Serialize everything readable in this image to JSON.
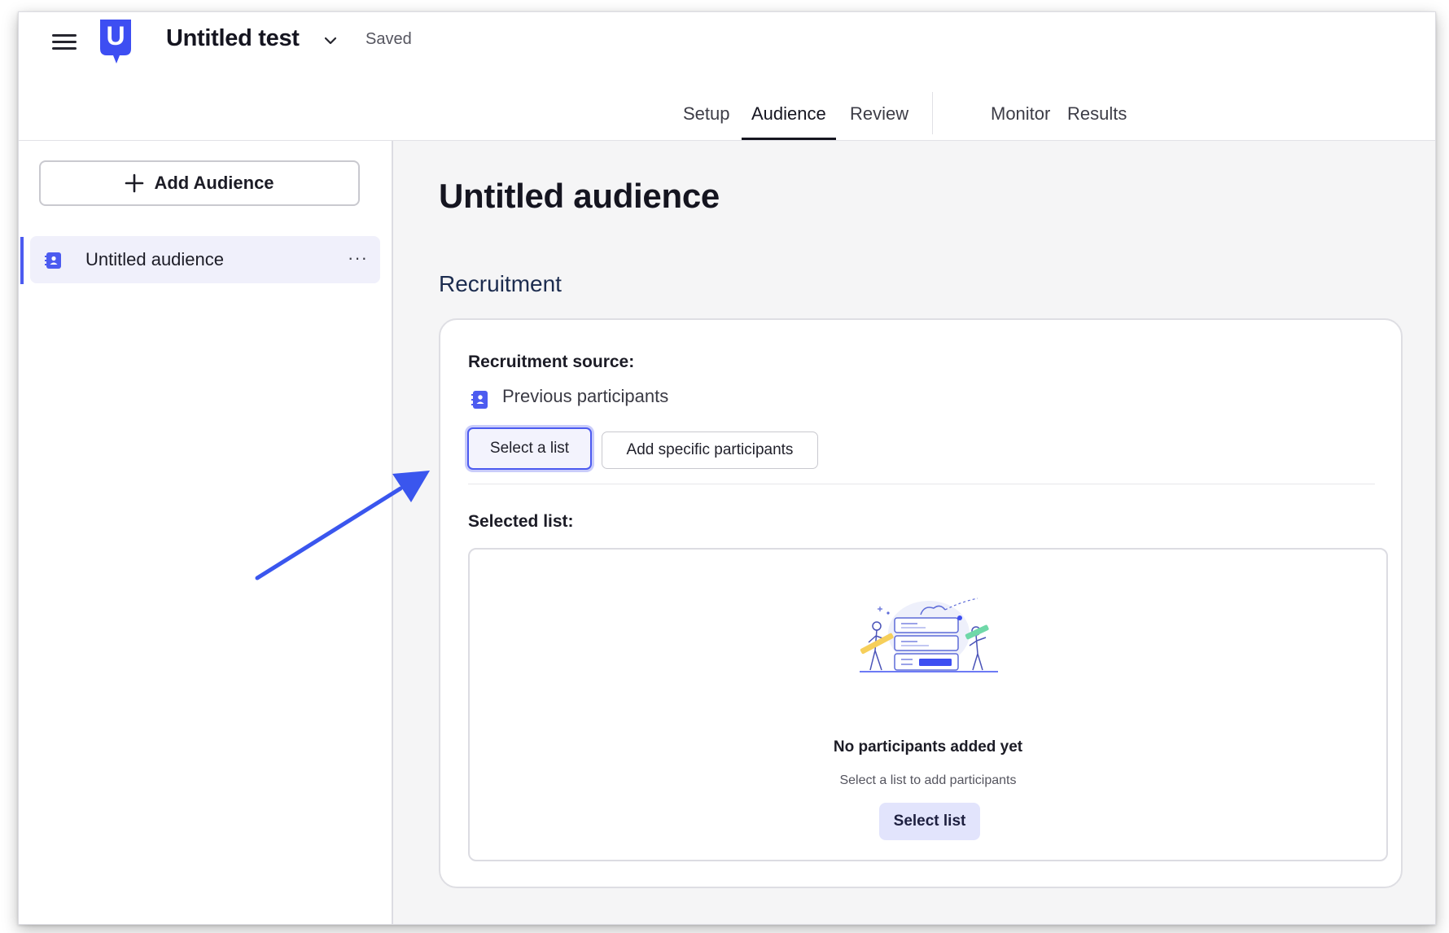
{
  "header": {
    "test_title": "Untitled test",
    "save_status": "Saved",
    "logo_letter": "U",
    "tabs": [
      {
        "label": "Setup"
      },
      {
        "label": "Audience"
      },
      {
        "label": "Review"
      },
      {
        "label": "Monitor"
      },
      {
        "label": "Results"
      }
    ],
    "active_tab": "Audience"
  },
  "sidebar": {
    "add_audience_label": "Add Audience",
    "audiences": [
      {
        "label": "Untitled audience",
        "more_label": "···"
      }
    ]
  },
  "main": {
    "page_title": "Untitled audience",
    "section_heading": "Recruitment",
    "recruitment": {
      "source_label": "Recruitment source:",
      "source_value": "Previous participants",
      "select_list_button": "Select a list",
      "add_specific_button": "Add specific participants",
      "selected_list_label": "Selected list:",
      "empty_title": "No participants added yet",
      "empty_subtitle": "Select a list to add participants",
      "select_list_cta": "Select list"
    }
  },
  "icons": {
    "menu": "hamburger-icon",
    "logo": "usertesting-logo",
    "title_dropdown": "chevron-down-icon",
    "add": "plus-icon",
    "audience": "contact-book-icon",
    "more": "more-horizontal-icon"
  },
  "colors": {
    "accent": "#4c5bf0",
    "logo": "#3d4ef2",
    "cta_background": "#e2e4fc",
    "arrow": "#3a56ee"
  }
}
